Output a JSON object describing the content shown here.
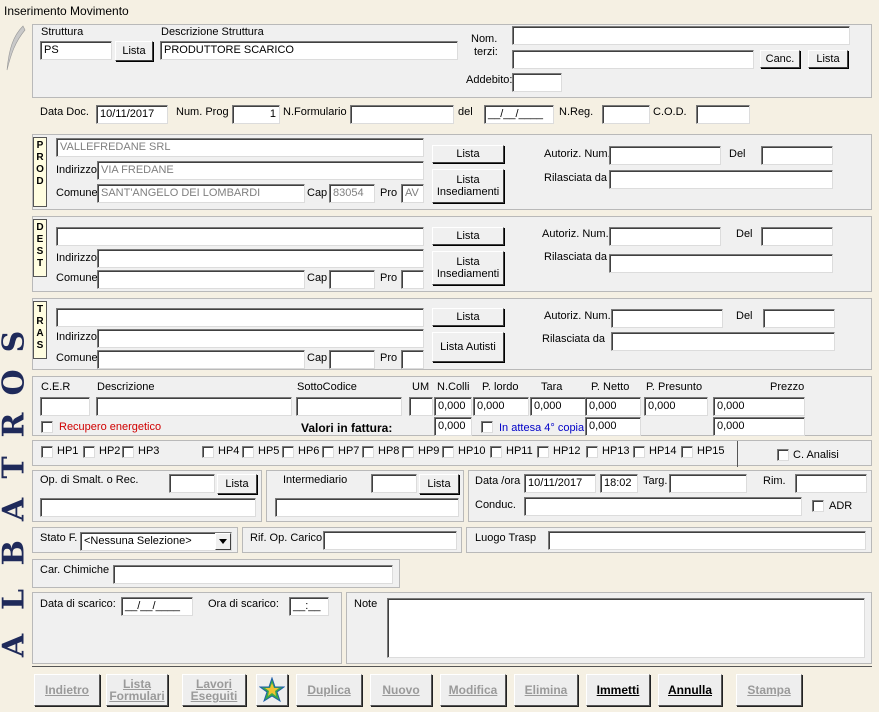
{
  "window": {
    "title": "Inserimento Movimento"
  },
  "logo": {
    "letters": [
      "S",
      "O",
      "R",
      "T",
      "A",
      "B",
      "L",
      "A"
    ]
  },
  "struttura": {
    "struttura_label": "Struttura",
    "struttura_value": "PS",
    "lista_label": "Lista",
    "descrizione_label": "Descrizione Struttura",
    "descrizione_value": "PRODUTTORE SCARICO",
    "nomterzi_label1": "Nom.",
    "nomterzi_label2": "terzi:",
    "nomterzi_value1": "",
    "nomterzi_value2": "",
    "canc_label": "Canc.",
    "lista2_label": "Lista",
    "addebito_label": "Addebito:",
    "addebito_value": ""
  },
  "doc": {
    "datadoc_label": "Data Doc.",
    "datadoc_value": "10/11/2017",
    "numprog_label": "Num. Prog",
    "numprog_value": "1",
    "nformulario_label": "N.Formulario",
    "nformulario_value": "",
    "del_label": "del",
    "del_value": "__/__/____",
    "nreg_label": "N.Reg.",
    "nreg_value": "",
    "cod_label": "C.O.D.",
    "cod_value": ""
  },
  "prod": {
    "tag": "P\nR\nO\nD",
    "name": "VALLEFREDANE SRL",
    "indirizzo_label": "Indirizzo",
    "indirizzo": "VIA FREDANE",
    "comune_label": "Comune",
    "comune": "SANT'ANGELO DEI LOMBARDI",
    "cap_label": "Cap",
    "cap": "83054",
    "pro_label": "Pro",
    "pro": "AV",
    "lista_label": "Lista",
    "lista_ins_label": "Lista\nInsediamenti",
    "autoriz_label": "Autoriz. Num.",
    "autoriz_value": "",
    "del_label": "Del",
    "del_value": "",
    "rilasciata_label": "Rilasciata da",
    "rilasciata_value": ""
  },
  "dest": {
    "tag": "D\nE\nS\nT",
    "name": "",
    "indirizzo_label": "Indirizzo",
    "indirizzo": "",
    "comune_label": "Comune",
    "comune": "",
    "cap_label": "Cap",
    "cap": "",
    "pro_label": "Pro",
    "pro": "",
    "lista_label": "Lista",
    "lista_ins_label": "Lista\nInsediamenti",
    "autoriz_label": "Autoriz. Num.",
    "autoriz_value": "",
    "del_label": "Del",
    "del_value": "",
    "rilasciata_label": "Rilasciata da",
    "rilasciata_value": ""
  },
  "tras": {
    "tag": "T\nR\nA\nS",
    "name": "",
    "indirizzo_label": "Indirizzo",
    "indirizzo": "",
    "comune_label": "Comune",
    "comune": "",
    "cap_label": "Cap",
    "cap": "",
    "pro_label": "Pro",
    "pro": "",
    "lista_label": "Lista",
    "lista_autisti_label": "Lista Autisti",
    "autoriz_label": "Autoriz. Num.",
    "autoriz_value": "",
    "del_label": "Del",
    "del_value": "",
    "rilasciata_label": "Rilasciata da",
    "rilasciata_value": ""
  },
  "rifiuto": {
    "cer_label": "C.E.R",
    "descrizione_label": "Descrizione",
    "sottocodice_label": "SottoCodice",
    "um_label": "UM",
    "ncolli_label": "N.Colli",
    "plordo_label": "P. lordo",
    "tara_label": "Tara",
    "pnetto_label": "P. Netto",
    "ppresunto_label": "P. Presunto",
    "prezzo_label": "Prezzo",
    "ncolli_value": "0,000",
    "plordo_value": "0,000",
    "tara_value": "0,000",
    "pnetto_value": "0,000",
    "ppresunto_value": "0,000",
    "prezzo_value": "0,000",
    "recupero_label": "Recupero energetico",
    "valori_label": "Valori in fattura:",
    "valori_value": "0,000",
    "attesa_label": "In attesa 4° copia",
    "attesa_value": "0,000",
    "prezzo2_value": "0,000"
  },
  "hp": {
    "items": [
      "HP1",
      "HP2",
      "HP3",
      "HP4",
      "HP5",
      "HP6",
      "HP7",
      "HP8",
      "HP9",
      "HP10",
      "HP11",
      "HP12",
      "HP13",
      "HP14",
      "HP15"
    ],
    "canalisi_label": "C. Analisi"
  },
  "opsmalt": {
    "label": "Op. di Smalt. o Rec.",
    "code": "",
    "lista_label": "Lista",
    "desc": "",
    "intermediario_label": "Intermediario",
    "intermediario_code": "",
    "intermediario_lista": "Lista",
    "intermediario_desc": "",
    "dataora_label": "Data /ora",
    "data_value": "10/11/2017",
    "ora_value": "18:02",
    "targ_label": "Targ.",
    "targ_value": "",
    "rim_label": "Rim.",
    "rim_value": "",
    "conduc_label": "Conduc.",
    "conduc_value": "",
    "adr_label": "ADR"
  },
  "stato": {
    "label": "Stato F.",
    "value": "<Nessuna Selezione>",
    "rifop_label": "Rif. Op. Carico",
    "rifop_value": "",
    "luogo_label": "Luogo Trasp",
    "luogo_value": ""
  },
  "carchimiche": {
    "label": "Car. Chimiche",
    "value": ""
  },
  "scarico": {
    "data_label": "Data di scarico:",
    "data_value": "__/__/____",
    "ora_label": "Ora di scarico:",
    "ora_value": "__:__"
  },
  "note": {
    "label": "Note",
    "value": ""
  },
  "buttons": {
    "indietro": "Indietro",
    "lista_formulari": "Lista\nFormulari",
    "lavori_eseguiti": "Lavori\nEseguiti",
    "duplica": "Duplica",
    "nuovo": "Nuovo",
    "modifica": "Modifica",
    "elimina": "Elimina",
    "immetti": "Immetti",
    "annulla": "Annulla",
    "stampa": "Stampa"
  },
  "colors": {
    "accent_red": "#d00000",
    "accent_blue": "#0000c8",
    "logo": "#1f2a5a"
  }
}
